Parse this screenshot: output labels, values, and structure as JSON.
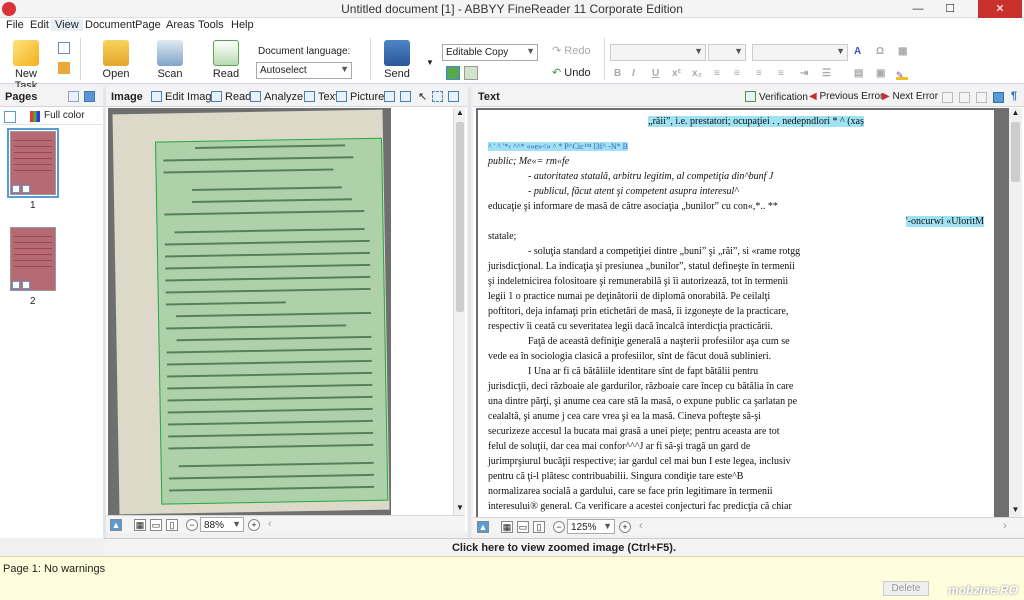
{
  "window": {
    "title": "Untitled document [1] - ABBYY FineReader 11 Corporate Edition",
    "minimize": "—",
    "maximize": "☐",
    "close": "✕"
  },
  "menu": [
    "File",
    "Edit",
    "View",
    "Document",
    "Page",
    "Areas",
    "Tools",
    "Help"
  ],
  "ribbon": {
    "new_task": "New Task",
    "open": "Open",
    "scan": "Scan",
    "read": "Read",
    "doc_lang_label": "Document language:",
    "doc_lang_value": "Autoselect",
    "send": "Send",
    "save_format": "Editable Copy",
    "redo": "Redo",
    "undo": "Undo"
  },
  "pages_panel": {
    "title": "Pages",
    "color_mode": "Full color",
    "thumbs": [
      "1",
      "2"
    ]
  },
  "image_panel": {
    "title": "Image",
    "tools": [
      "Edit Image",
      "Read",
      "Analyze",
      "Text",
      "Picture"
    ],
    "zoom": "88%"
  },
  "text_panel": {
    "title": "Text",
    "verification": "Verification",
    "previous_error": "Previous Error",
    "next_error": "Next Error",
    "zoom": "125%",
    "lines": [
      "„răii”, i.e. prestatori; ocupaţiei . , nedepndlori * ^ (xaș",
      "^ ' ^ '*‹ ^^* «»e»<» ^ * P^Cic™ l3f^ -N* B",
      "public;                                   Me«= rm«fe",
      "- autoritatea statală, arbitru legitim, al competiţia din^bunf J",
      "- publicul, făcut atent şi competent asupra interesul^",
      "educaţie şi informare de masă de către asociaţia „bunilor” cu con«,*.. **",
      "'-oncurwi «UloritM",
      "statale;",
      "- soluţia standard a competiţiei dintre „buni” şi „răi”, si «rame rotgg",
      "jurisdicţional. La indicaţia şi presiunea „bunilor”, statul defineşte în termenii",
      "şi indeletnicirea folositoare şi remunerabilă şi îi autorizează, tot în termenii",
      "legii 1 o practice numai pe deţinătorii de diplomă onorabilă. Pe ceilalţi",
      "poftitori, deja infamaţi prin etichetări de masă, îi izgoneşte de la practicare,",
      "respectiv îi ceată cu severitatea legii dacă încalcă interdicţia practicării.",
      "Faţă de această definiţie generală a naşterii profesiilor aşa cum se",
      "vede ea în sociologia clasică a profesiilor, sînt de făcut două sublinieri.",
      "I Una ar fi că bătăliile identitare sînt de fapt bătălii pentru",
      "jurisdicţii, deci războaie ale gardurilor, războaie care încep cu bătălia în care",
      "una dintre părţi, şi anume cea care stă la masă, o expune public ca şarlatan pe",
      "cealaltă, şi anume j cea care vrea şi ea la masă. Cineva pofteşte să-şi",
      "securizeze accesul la bucata mai grasă a unei pieţe; pentru aceasta are tot",
      "felul de soluţii, dar cea mai confor^^^J ar fi să-şi tragă un gard de",
      "jurimprşiurul bucăţii respective; iar gardul cel mai bun I este legea, inclusiv",
      "pentru că ţi-l plătesc contribuabilii. Singura condiţie tare este^B",
      "normalizarea socială a gardului, care se face prin legitimare în termenii",
      "interesului® general. Ca verificare a acestei conjecturi fac predicţia că chiar"
    ]
  },
  "zoomed_hint": "Click here to view zoomed image (Ctrl+F5).",
  "status": {
    "message": "Page 1: No warnings",
    "delete": "Delete"
  },
  "watermark": "mobzine.RO",
  "colors": {
    "accent": "#5b9bd5",
    "highlight": "#9ee2f4",
    "ocr_zone": "#22a844",
    "close": "#c8312b"
  }
}
